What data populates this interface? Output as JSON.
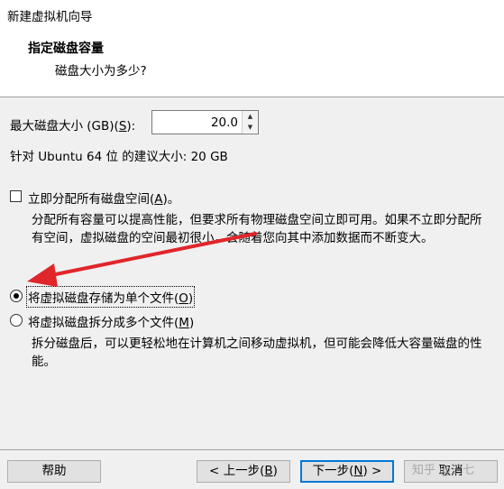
{
  "window": {
    "title": "新建虚拟机向导"
  },
  "header": {
    "title": "指定磁盘容量",
    "subtitle": "磁盘大小为多少?"
  },
  "max_size": {
    "label": "最大磁盘大小 (GB)(",
    "accel": "S",
    "label_end": "):",
    "value": "20.0"
  },
  "recommend": "针对 Ubuntu 64 位 的建议大小: 20 GB",
  "allocate": {
    "label": "立即分配所有磁盘空间(",
    "accel": "A",
    "label_end": ")。",
    "checked": false,
    "desc": "分配所有容量可以提高性能，但要求所有物理磁盘空间立即可用。如果不立即分配所有空间，虚拟磁盘的空间最初很小，会随着您向其中添加数据而不断变大。"
  },
  "single_file": {
    "label": "将虚拟磁盘存储为单个文件(",
    "accel": "O",
    "label_end": ")",
    "selected": true
  },
  "multi_file": {
    "label": "将虚拟磁盘拆分成多个文件(",
    "accel": "M",
    "label_end": ")",
    "selected": false,
    "desc": "拆分磁盘后，可以更轻松地在计算机之间移动虚拟机，但可能会降低大容量磁盘的性能。"
  },
  "buttons": {
    "help": "帮助",
    "back": "< 上一步(",
    "back_accel": "B",
    "back_end": ")",
    "next": "下一步(",
    "next_accel": "N",
    "next_end": ") >",
    "cancel": "取消"
  },
  "watermark": "知乎 @三七",
  "colors": {
    "arrow": "#e0262a",
    "accent": "#0078d7"
  }
}
